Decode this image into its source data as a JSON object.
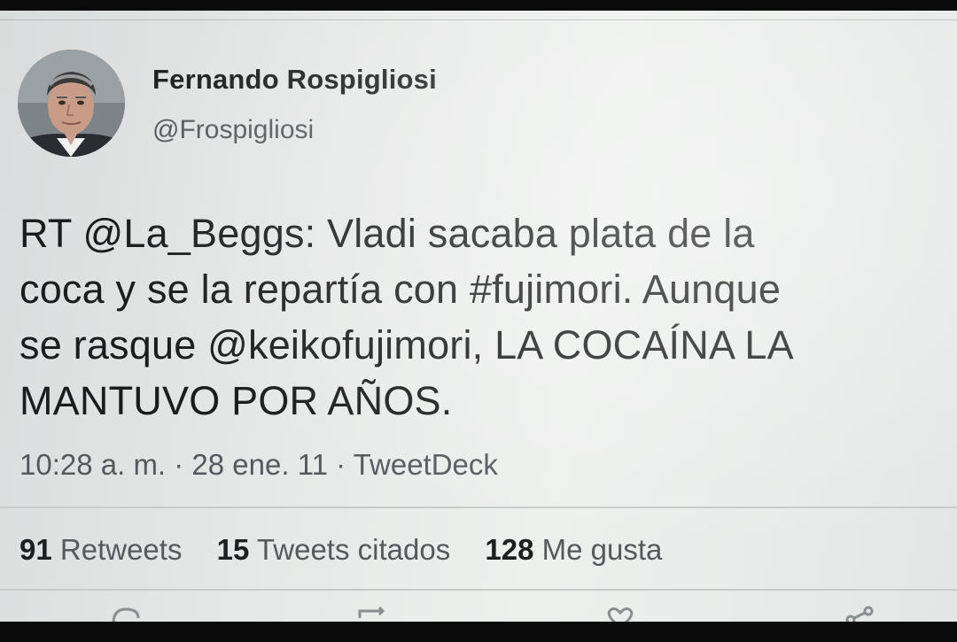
{
  "tweet": {
    "author_name": "Fernando Rospigliosi",
    "author_handle": "@Frospigliosi",
    "text_lines": [
      "RT @La_Beggs: Vladi sacaba plata de la",
      "coca y se la repartía con #fujimori. Aunque",
      "se rasque @keikofujimori, LA COCAÍNA LA",
      "MANTUVO POR AÑOS."
    ],
    "meta": "10:28 a. m. · 28 ene. 11 · TweetDeck",
    "stats": {
      "retweets_count": "91",
      "retweets_label": "Retweets",
      "quotes_count": "15",
      "quotes_label": "Tweets citados",
      "likes_count": "128",
      "likes_label": "Me gusta"
    }
  },
  "icons": {
    "reply": "reply-icon",
    "retweet": "retweet-icon",
    "like": "heart-icon",
    "share": "share-icon"
  },
  "colors": {
    "screen_background": "#e7e9e8",
    "text_primary": "#1a1c1d",
    "text_secondary": "#55595c",
    "frame": "#0b0b0b"
  }
}
